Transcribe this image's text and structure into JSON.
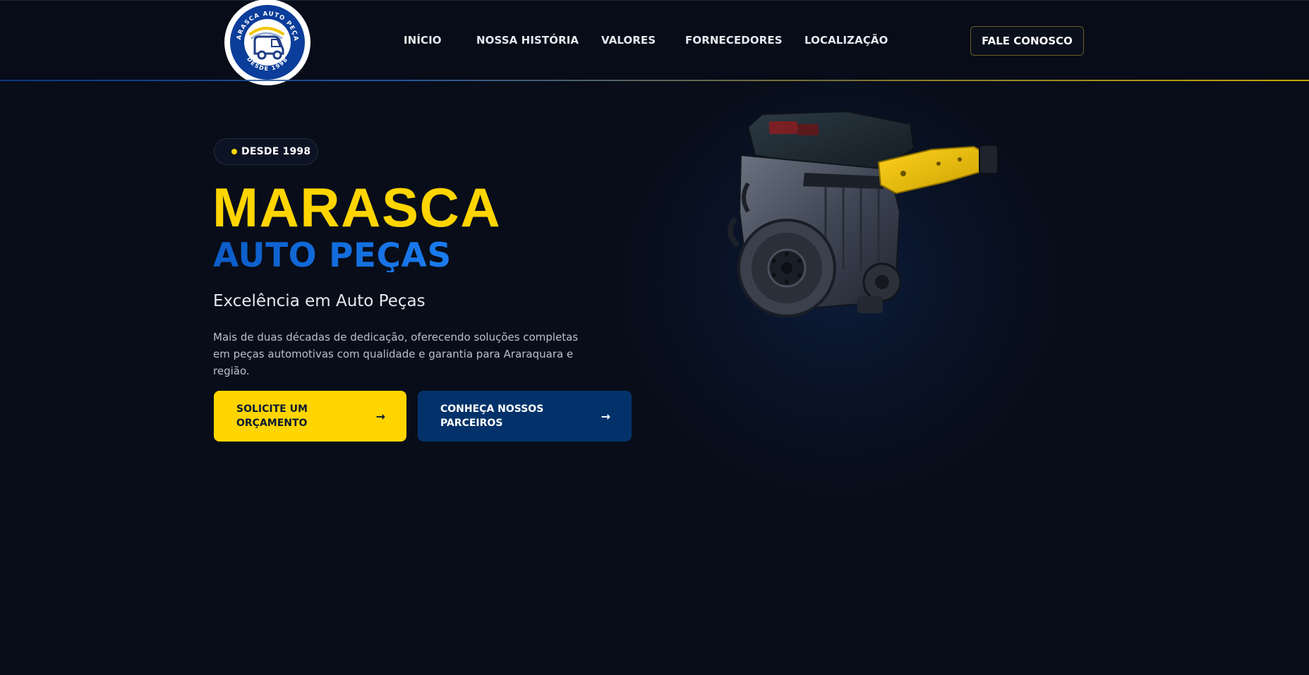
{
  "brand": {
    "logo_ring_text": "MARASCA AUTO PEÇAS",
    "logo_since_text": "DESDE 1998",
    "colors": {
      "yellow": "#ffd500",
      "blue": "#0b5cc7",
      "navy": "#03326a",
      "background": "#080d19"
    }
  },
  "nav": {
    "items": [
      {
        "label": "INÍCIO"
      },
      {
        "label": "NOSSA HISTÓRIA"
      },
      {
        "label": "VALORES"
      },
      {
        "label": "FORNECEDORES"
      },
      {
        "label": "LOCALIZAÇÃO"
      }
    ],
    "cta_label": "FALE CONOSCO"
  },
  "hero": {
    "badge": "DESDE 1998",
    "title_line1": "MARASCA",
    "title_line2": "AUTO PEÇAS",
    "subtitle": "Excelência em Auto Peças",
    "description": "Mais de duas décadas de dedicação, oferecendo soluções completas em peças automotivas com qualidade e garantia para Araraquara e região.",
    "primary_button": {
      "label": "SOLICITE UM ORÇAMENTO",
      "arrow": "→"
    },
    "secondary_button": {
      "label": "CONHEÇA NOSSOS PARCEIROS",
      "arrow": "→"
    },
    "image_icon": "engine-block-illustration"
  }
}
